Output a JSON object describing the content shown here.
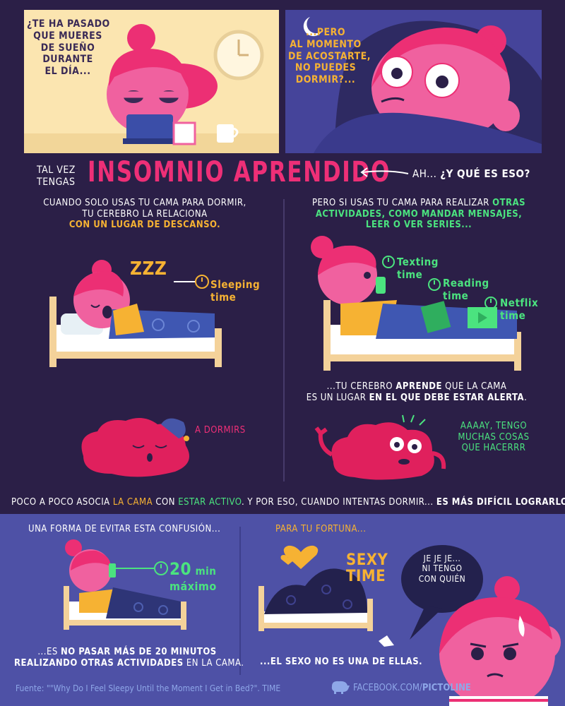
{
  "panel1": {
    "lines": [
      "¿TE HA PASADO",
      "QUE MUERES",
      "DE SUEÑO",
      "DURANTE",
      "EL DÍA..."
    ]
  },
  "panel2": {
    "lines": [
      "...PERO",
      "AL MOMENTO",
      "DE ACOSTARTE,",
      "NO PUEDES",
      "DORMIR?..."
    ]
  },
  "heading": {
    "pre_line1": "TAL VEZ",
    "pre_line2": "TENGAS",
    "title": "INSOMNIO APRENDIDO",
    "aside_prefix": "AH... ",
    "aside_question": "¿Y QUÉ ES ESO?"
  },
  "left_col": {
    "line1": "CUANDO SOLO USAS TU CAMA PARA DORMIR,",
    "line2": "TU CEREBRO LA RELACIONA",
    "line3": "CON UN LUGAR DE DESCANSO.",
    "sleeping_label_1": "Sleeping",
    "sleeping_label_2": "time",
    "zzz": "zZZ",
    "brain_text": "A DORMIRS"
  },
  "right_col": {
    "line1_prefix": "PERO SI USAS TU CAMA PARA REALIZAR ",
    "line1_green": "OTRAS",
    "line2": "ACTIVIDADES, COMO MANDAR MENSAJES,",
    "line3": "LEER O VER SERIES...",
    "texting_1": "Texting",
    "texting_2": "time",
    "reading_1": "Reading",
    "reading_2": "time",
    "netflix_1": "Netflix",
    "netflix_2": "time",
    "learn_p1": "...TU CEREBRO ",
    "learn_b1": "APRENDE",
    "learn_p2": " QUE LA CAMA",
    "learn2_p1": "ES UN LUGAR ",
    "learn2_b1": "EN EL QUE DEBE ESTAR ALERTA",
    "learn2_p2": ".",
    "brain_text_1": "AAAAY, TENGO",
    "brain_text_2": "MUCHAS COSAS",
    "brain_text_3": "QUE HACERRR"
  },
  "summary": {
    "p1": "POCO A POCO ASOCIA ",
    "h1": "LA CAMA",
    "p2": " CON ",
    "h2": "ESTAR ACTIVO",
    "p3": ". Y POR ESO, CUANDO INTENTAS DORMIR... ",
    "h3": "ES MÁS DIFÍCIL LOGRARLO."
  },
  "bottom_left": {
    "title": "UNA FORMA DE EVITAR ESTA CONFUSIÓN...",
    "min_num": "20",
    "min_unit": "min",
    "min_max": "máximo",
    "caption1_p": "...ES ",
    "caption1_b": "NO PASAR MÁS DE 20 MINUTOS",
    "caption2_b": "REALIZANDO OTRAS ACTIVIDADES",
    "caption2_p": " EN LA CAMA."
  },
  "bottom_right": {
    "title": "PARA TU FORTUNA...",
    "sexy_1": "SEXY",
    "sexy_2": "TIME",
    "caption": "...EL SEXO NO ES UNA DE ELLAS.",
    "bubble_1": "JE JE JE...",
    "bubble_2": "NI TENGO",
    "bubble_3": "CON QUIÉN"
  },
  "footer": {
    "source": "Fuente: \"\"Why Do I Feel Sleepy Until the Moment I Get in Bed?\". TIME",
    "fb_prefix": "FACEBOOK.COM/",
    "fb_brand": "PICTOLINE"
  },
  "colors": {
    "background": "#2b1f47",
    "bottom_panel": "#4e51a6",
    "title_pink": "#ee2f77",
    "yellow": "#f6b233",
    "green": "#4be37f"
  }
}
